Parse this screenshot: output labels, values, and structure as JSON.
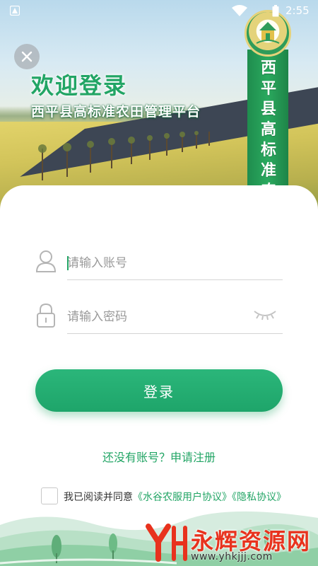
{
  "status_bar": {
    "time": "2:55",
    "icons": [
      "app-notification-icon",
      "wifi-icon",
      "battery-icon"
    ]
  },
  "header": {
    "welcome_title": "欢迎登录",
    "platform_subtitle": "西平县高标准农田管理平台",
    "tower_text": "西平县高标准农田",
    "logo_icon": "farmland-emblem-icon"
  },
  "login_form": {
    "account_placeholder": "请输入账号",
    "account_value": "",
    "password_placeholder": "请输入密码",
    "password_value": "",
    "login_label": "登录",
    "register_text": "还没有账号？申请注册"
  },
  "agreement": {
    "prefix": "我已阅读并同意",
    "user_agreement": "《水谷农服用户协议》",
    "privacy_policy": "《隐私协议》",
    "checked": false
  },
  "watermark": {
    "brand": "永辉资源网",
    "url": "www.yhkjjj.com"
  },
  "colors": {
    "accent": "#22a565",
    "button": "#1ea56a",
    "watermark_red": "#e8321d"
  }
}
